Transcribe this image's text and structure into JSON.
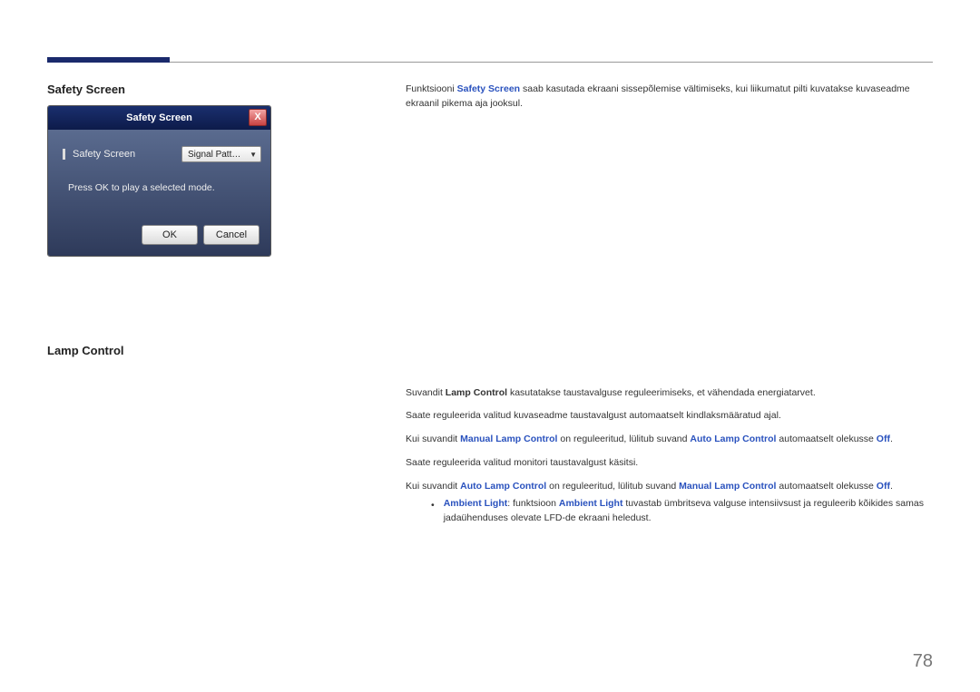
{
  "section1": {
    "title": "Safety Screen",
    "dialog": {
      "title": "Safety Screen",
      "close_x": "X",
      "row_label": "Safety Screen",
      "select_value": "Signal Patt…",
      "message": "Press OK to play a selected mode.",
      "ok": "OK",
      "cancel": "Cancel"
    },
    "para1_a": "Funktsiooni ",
    "para1_hl": "Safety Screen",
    "para1_b": " saab kasutada ekraani sissepõlemise vältimiseks, kui liikumatut pilti kuvatakse kuvaseadme ekraanil pikema aja jooksul."
  },
  "section2": {
    "title": "Lamp Control",
    "p1_a": "Suvandit ",
    "p1_hl": "Lamp Control",
    "p1_b": " kasutatakse taustavalguse reguleerimiseks, et vähendada energiatarvet.",
    "p2": "Saate reguleerida valitud kuvaseadme taustavalgust automaatselt kindlaksmääratud ajal.",
    "p3_a": "Kui suvandit ",
    "p3_hl1": "Manual Lamp Control",
    "p3_b": " on reguleeritud, lülitub suvand ",
    "p3_hl2": "Auto Lamp Control",
    "p3_c": " automaatselt olekusse ",
    "p3_hl3": "Off",
    "p3_d": ".",
    "p4": "Saate reguleerida valitud monitori taustavalgust käsitsi.",
    "p5_a": "Kui suvandit ",
    "p5_hl1": "Auto Lamp Control",
    "p5_b": " on reguleeritud, lülitub suvand ",
    "p5_hl2": "Manual Lamp Control",
    "p5_c": " automaatselt olekusse ",
    "p5_hl3": "Off",
    "p5_d": ".",
    "bullet_hl1": "Ambient Light",
    "bullet_a": ": funktsioon ",
    "bullet_hl2": "Ambient Light",
    "bullet_b": " tuvastab ümbritseva valguse intensiivsust ja reguleerib kõikides samas jadaühenduses olevate LFD-de ekraani heledust."
  },
  "page_number": "78"
}
